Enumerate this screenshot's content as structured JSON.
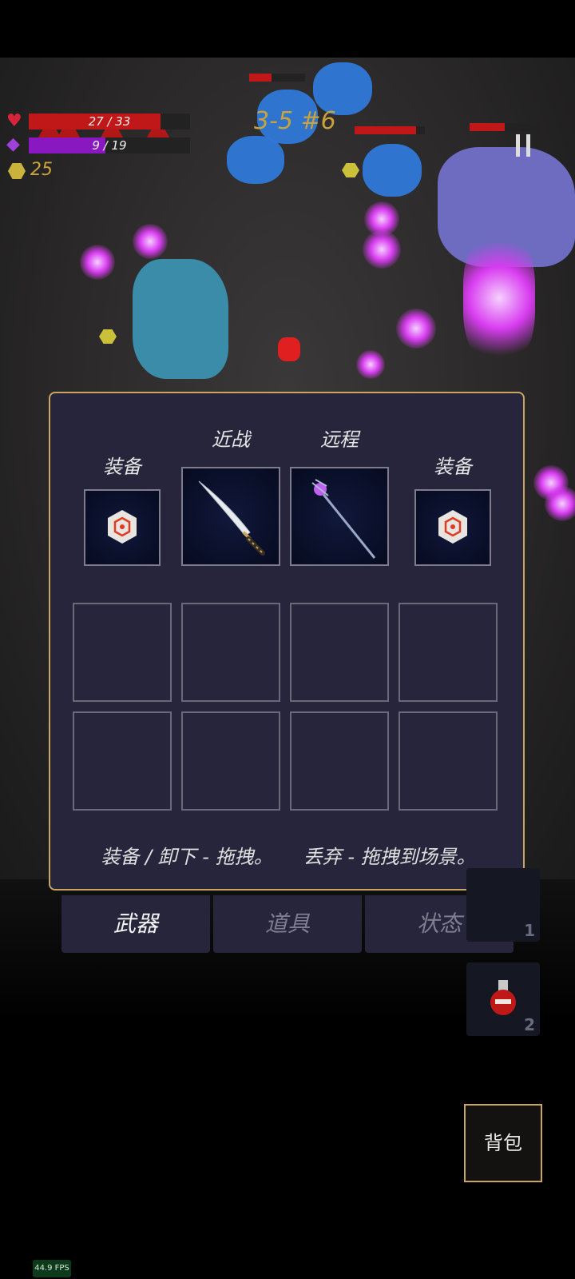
{
  "hud": {
    "hp_text": "27 / 33",
    "hp_fraction": 0.818,
    "mana_text": "9 / 19",
    "mana_fraction": 0.474,
    "coins": "25",
    "wave": "3-5 #6",
    "hp_icon": "heart-icon",
    "mana_icon": "diamond-icon",
    "coin_icon": "hexagon-coin-icon",
    "pause_icon": "pause-icon"
  },
  "inventory": {
    "melee_label": "近战",
    "ranged_label": "远程",
    "equip_left_label": "装备",
    "equip_right_label": "装备",
    "melee_weapon_icon": "katana-icon",
    "ranged_weapon_icon": "magic-staff-icon",
    "equip_left_icon": "hexagon-rune-stone-icon",
    "equip_right_icon": "hexagon-rune-stone-icon",
    "hint_equip": "装备 / 卸下 - 拖拽。",
    "hint_discard": "丢弃 - 拖拽到场景。"
  },
  "tabs": [
    {
      "label": "武器",
      "active": true
    },
    {
      "label": "道具",
      "active": false
    },
    {
      "label": "状态",
      "active": false
    }
  ],
  "quick_slots": [
    {
      "count": "1",
      "icon": "item-icon"
    },
    {
      "count": "2",
      "icon": "red-potion-icon"
    }
  ],
  "bag_button": "背包",
  "fps": "44.9 FPS",
  "colors": {
    "accent_gold": "#c9a660",
    "hp_red": "#c01818",
    "mana_purple": "#8a18c0",
    "panel_bg": "#27253b"
  }
}
